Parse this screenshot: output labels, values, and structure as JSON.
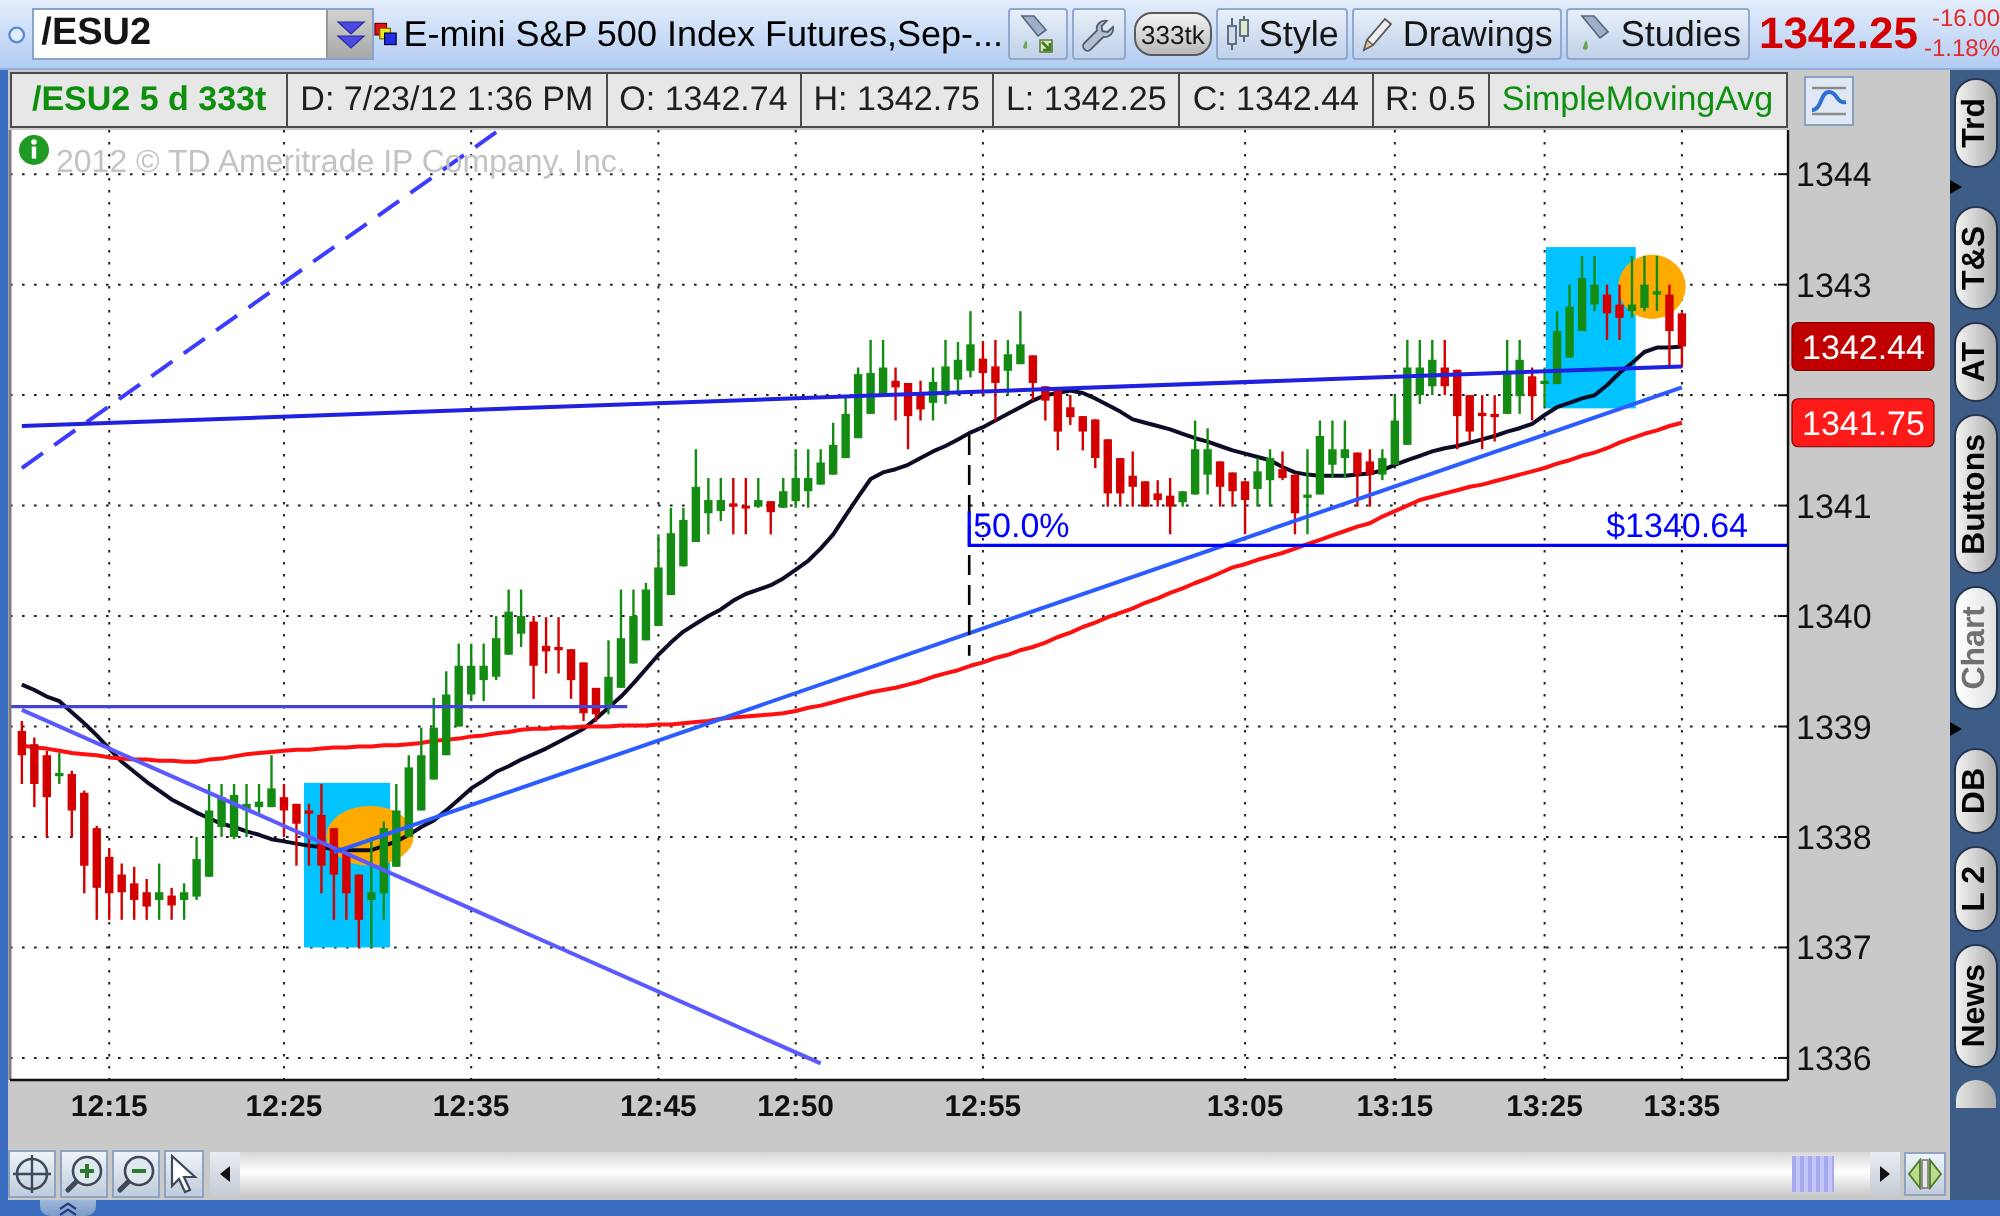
{
  "symbol_bar": {
    "symbol": "/ESU2",
    "description": "E-mini S&P 500 Index Futures,Sep-...",
    "buttons": [
      {
        "kind": "flask_arrow"
      },
      {
        "kind": "wrench"
      },
      {
        "kind": "pill",
        "label": "333tk"
      },
      {
        "kind": "candles",
        "label": "Style"
      },
      {
        "kind": "pencil",
        "label": "Drawings"
      },
      {
        "kind": "flask",
        "label": "Studies"
      }
    ],
    "last": "1342.25",
    "change": "-16.00",
    "change_percent": "-1.18%"
  },
  "info_bar": {
    "symbol": "/ESU2 5 d 333t",
    "fields": [
      "D: 7/23/12 1:36 PM",
      "O: 1342.74",
      "H: 1342.75",
      "L: 1342.25",
      "C: 1342.44",
      "R: 0.5"
    ],
    "study": "SimpleMovingAvg"
  },
  "chart": {
    "copyright": "2012 © TD Ameritrade IP Company, Inc.",
    "price_tags": [
      {
        "label": "1342.44",
        "color": "#c00000"
      },
      {
        "label": "1341.75",
        "color": "#ff1a1a"
      }
    ],
    "chart_data": [
      {
        "type": "candlestick",
        "categories": [
          null,
          null,
          null,
          null,
          null,
          null,
          null,
          "12:15",
          null,
          null,
          null,
          null,
          null,
          null,
          null,
          null,
          null,
          null,
          null,
          null,
          null,
          "12:25",
          null,
          null,
          null,
          null,
          null,
          null,
          null,
          null,
          null,
          null,
          null,
          null,
          null,
          null,
          "12:35",
          null,
          null,
          null,
          null,
          null,
          null,
          null,
          null,
          null,
          null,
          null,
          null,
          null,
          null,
          "12:45",
          null,
          null,
          null,
          null,
          null,
          null,
          null,
          null,
          null,
          null,
          "12:50",
          null,
          null,
          null,
          null,
          null,
          null,
          null,
          null,
          null,
          null,
          null,
          null,
          null,
          null,
          "12:55",
          null,
          null,
          null,
          null,
          null,
          null,
          null,
          null,
          null,
          null,
          null,
          null,
          null,
          null,
          null,
          null,
          null,
          null,
          null,
          null,
          "13:05",
          null,
          null,
          null,
          null,
          null,
          null,
          null,
          null,
          null,
          null,
          null,
          "13:15",
          null,
          null,
          null,
          null,
          null,
          null,
          null,
          null,
          null,
          null,
          null,
          "13:25",
          null,
          null,
          null,
          null,
          null,
          null,
          null,
          null,
          null,
          null,
          "13:35"
        ],
        "ohlc": [
          [
            1338.96,
            1339.05,
            1338.48,
            1338.74
          ],
          [
            1338.84,
            1338.9,
            1338.27,
            1338.48
          ],
          [
            1338.74,
            1338.78,
            1338.0,
            1338.36
          ],
          [
            1338.55,
            1338.76,
            1338.48,
            1338.58
          ],
          [
            1338.57,
            1338.6,
            1338.0,
            1338.24
          ],
          [
            1338.4,
            1338.42,
            1337.49,
            1337.74
          ],
          [
            1338.08,
            1338.1,
            1337.25,
            1337.54
          ],
          [
            1337.82,
            1337.9,
            1337.25,
            1337.49
          ],
          [
            1337.66,
            1337.76,
            1337.25,
            1337.5
          ],
          [
            1337.58,
            1337.73,
            1337.25,
            1337.43
          ],
          [
            1337.5,
            1337.62,
            1337.25,
            1337.37
          ],
          [
            1337.43,
            1337.76,
            1337.25,
            1337.5
          ],
          [
            1337.47,
            1337.54,
            1337.25,
            1337.38
          ],
          [
            1337.43,
            1337.58,
            1337.25,
            1337.5
          ],
          [
            1337.46,
            1338.0,
            1337.43,
            1337.8
          ],
          [
            1337.64,
            1338.48,
            1337.64,
            1338.24
          ],
          [
            1338.09,
            1338.48,
            1338.0,
            1338.36
          ],
          [
            1338.0,
            1338.48,
            1337.98,
            1338.38
          ],
          [
            1338.24,
            1338.48,
            1338.0,
            1338.3
          ],
          [
            1338.27,
            1338.48,
            1338.2,
            1338.32
          ],
          [
            1338.27,
            1338.74,
            1338.27,
            1338.44
          ],
          [
            1338.36,
            1338.48,
            1338.0,
            1338.24
          ],
          [
            1338.3,
            1338.3,
            1337.74,
            1338.12
          ],
          [
            1338.24,
            1338.3,
            1337.74,
            1338.21
          ],
          [
            1338.2,
            1338.48,
            1337.49,
            1337.74
          ],
          [
            1338.08,
            1338.08,
            1337.25,
            1337.66
          ],
          [
            1337.85,
            1337.91,
            1337.25,
            1337.49
          ],
          [
            1337.66,
            1337.66,
            1337.0,
            1337.25
          ],
          [
            1337.43,
            1338.0,
            1337.0,
            1337.5
          ],
          [
            1337.49,
            1338.14,
            1337.25,
            1338.08
          ],
          [
            1337.73,
            1338.48,
            1337.73,
            1338.24
          ],
          [
            1338.0,
            1338.74,
            1338.0,
            1338.63
          ],
          [
            1338.24,
            1338.99,
            1338.24,
            1338.74
          ],
          [
            1338.52,
            1339.26,
            1338.52,
            1338.99
          ],
          [
            1338.74,
            1339.5,
            1338.74,
            1339.29
          ],
          [
            1339.0,
            1339.75,
            1339.0,
            1339.55
          ],
          [
            1339.29,
            1339.75,
            1339.23,
            1339.55
          ],
          [
            1339.42,
            1339.75,
            1339.23,
            1339.55
          ],
          [
            1339.45,
            1340.0,
            1339.42,
            1339.8
          ],
          [
            1339.65,
            1340.24,
            1339.65,
            1340.04
          ],
          [
            1339.84,
            1340.24,
            1339.72,
            1340.0
          ],
          [
            1339.95,
            1340.0,
            1339.25,
            1339.55
          ],
          [
            1339.73,
            1339.99,
            1339.48,
            1339.68
          ],
          [
            1339.72,
            1339.99,
            1339.48,
            1339.69
          ],
          [
            1339.7,
            1339.7,
            1339.25,
            1339.42
          ],
          [
            1339.58,
            1339.58,
            1339.05,
            1339.12
          ],
          [
            1339.35,
            1339.35,
            1339.04,
            1339.11
          ],
          [
            1339.17,
            1339.78,
            1339.11,
            1339.45
          ],
          [
            1339.35,
            1340.24,
            1339.35,
            1339.8
          ],
          [
            1339.57,
            1340.24,
            1339.57,
            1340.0
          ],
          [
            1339.78,
            1340.3,
            1339.78,
            1340.24
          ],
          [
            1339.91,
            1340.74,
            1339.91,
            1340.44
          ],
          [
            1340.19,
            1340.98,
            1340.19,
            1340.75
          ],
          [
            1340.45,
            1340.98,
            1340.45,
            1340.87
          ],
          [
            1340.67,
            1341.51,
            1340.67,
            1341.17
          ],
          [
            1340.93,
            1341.25,
            1340.74,
            1341.05
          ],
          [
            1340.95,
            1341.25,
            1340.86,
            1341.05
          ],
          [
            1341.02,
            1341.25,
            1340.74,
            1340.99
          ],
          [
            1341.0,
            1341.25,
            1340.74,
            1340.98
          ],
          [
            1340.99,
            1341.25,
            1340.98,
            1341.05
          ],
          [
            1341.04,
            1341.04,
            1340.74,
            1340.94
          ],
          [
            1340.98,
            1341.25,
            1340.98,
            1341.13
          ],
          [
            1341.04,
            1341.51,
            1340.98,
            1341.25
          ],
          [
            1341.13,
            1341.51,
            1340.98,
            1341.25
          ],
          [
            1341.19,
            1341.51,
            1341.19,
            1341.39
          ],
          [
            1341.28,
            1341.75,
            1341.28,
            1341.55
          ],
          [
            1341.43,
            1342.0,
            1341.43,
            1341.83
          ],
          [
            1341.61,
            1342.25,
            1341.61,
            1342.19
          ],
          [
            1341.83,
            1342.5,
            1341.83,
            1342.2
          ],
          [
            1342.0,
            1342.5,
            1342.0,
            1342.25
          ],
          [
            1342.13,
            1342.25,
            1341.77,
            1342.07
          ],
          [
            1342.11,
            1342.11,
            1341.51,
            1341.81
          ],
          [
            1342.0,
            1342.13,
            1341.77,
            1341.87
          ],
          [
            1341.93,
            1342.25,
            1341.77,
            1342.12
          ],
          [
            1342.0,
            1342.5,
            1341.92,
            1342.26
          ],
          [
            1342.14,
            1342.48,
            1342.0,
            1342.32
          ],
          [
            1342.22,
            1342.76,
            1342.16,
            1342.46
          ],
          [
            1342.33,
            1342.49,
            1342.0,
            1342.2
          ],
          [
            1342.26,
            1342.5,
            1341.77,
            1342.11
          ],
          [
            1342.22,
            1342.5,
            1342.0,
            1342.37
          ],
          [
            1342.28,
            1342.76,
            1342.28,
            1342.46
          ],
          [
            1342.36,
            1342.36,
            1341.95,
            1342.11
          ],
          [
            1342.08,
            1342.08,
            1341.77,
            1341.95
          ],
          [
            1342.05,
            1342.05,
            1341.5,
            1341.67
          ],
          [
            1341.89,
            1342.0,
            1341.73,
            1341.8
          ],
          [
            1341.81,
            1341.81,
            1341.5,
            1341.67
          ],
          [
            1341.78,
            1341.78,
            1341.34,
            1341.43
          ],
          [
            1341.6,
            1341.6,
            1340.99,
            1341.11
          ],
          [
            1341.43,
            1341.43,
            1340.99,
            1341.11
          ],
          [
            1341.27,
            1341.49,
            1340.99,
            1341.17
          ],
          [
            1341.22,
            1341.22,
            1340.99,
            1340.99
          ],
          [
            1341.11,
            1341.23,
            1340.99,
            1341.05
          ],
          [
            1341.09,
            1341.25,
            1340.74,
            1340.99
          ],
          [
            1341.03,
            1341.13,
            1340.99,
            1341.13
          ],
          [
            1341.1,
            1341.77,
            1341.1,
            1341.51
          ],
          [
            1341.28,
            1341.7,
            1341.1,
            1341.51
          ],
          [
            1341.4,
            1341.4,
            1340.99,
            1341.17
          ],
          [
            1341.3,
            1341.3,
            1340.99,
            1341.13
          ],
          [
            1341.22,
            1341.22,
            1340.74,
            1341.05
          ],
          [
            1341.15,
            1341.43,
            1340.99,
            1341.31
          ],
          [
            1341.23,
            1341.51,
            1340.99,
            1341.43
          ],
          [
            1341.33,
            1341.49,
            1341.23,
            1341.25
          ],
          [
            1341.28,
            1341.28,
            1340.74,
            1340.93
          ],
          [
            1341.07,
            1341.51,
            1340.74,
            1341.1
          ],
          [
            1341.1,
            1341.77,
            1341.1,
            1341.63
          ],
          [
            1341.37,
            1341.77,
            1341.25,
            1341.51
          ],
          [
            1341.43,
            1341.77,
            1341.25,
            1341.51
          ],
          [
            1341.48,
            1341.48,
            1340.99,
            1341.28
          ],
          [
            1341.4,
            1341.51,
            1340.99,
            1341.28
          ],
          [
            1341.28,
            1341.51,
            1341.23,
            1341.43
          ],
          [
            1341.37,
            1342.0,
            1341.37,
            1341.77
          ],
          [
            1341.55,
            1342.5,
            1341.55,
            1342.25
          ],
          [
            1342.0,
            1342.5,
            1341.92,
            1342.25
          ],
          [
            1342.08,
            1342.5,
            1342.0,
            1342.32
          ],
          [
            1342.25,
            1342.5,
            1342.0,
            1342.08
          ],
          [
            1342.23,
            1342.23,
            1341.51,
            1341.81
          ],
          [
            1342.0,
            1342.0,
            1341.58,
            1341.67
          ],
          [
            1341.84,
            1342.0,
            1341.51,
            1341.81
          ],
          [
            1341.83,
            1342.0,
            1341.58,
            1341.8
          ],
          [
            1341.83,
            1342.5,
            1341.83,
            1342.22
          ],
          [
            1341.99,
            1342.5,
            1341.83,
            1342.32
          ],
          [
            1342.17,
            1342.25,
            1341.77,
            1341.99
          ],
          [
            1342.1,
            1342.25,
            1341.89,
            1342.13
          ],
          [
            1342.1,
            1342.76,
            1342.1,
            1342.58
          ],
          [
            1342.34,
            1343.0,
            1342.34,
            1342.8
          ],
          [
            1342.58,
            1343.26,
            1342.58,
            1343.06
          ],
          [
            1342.82,
            1343.26,
            1342.76,
            1343.0
          ],
          [
            1342.91,
            1343.0,
            1342.5,
            1342.74
          ],
          [
            1342.82,
            1343.0,
            1342.5,
            1342.7
          ],
          [
            1342.76,
            1343.26,
            1342.7,
            1342.82
          ],
          [
            1342.79,
            1343.26,
            1342.76,
            1343.0
          ],
          [
            1342.91,
            1343.26,
            1342.76,
            1342.94
          ],
          [
            1342.91,
            1343.0,
            1342.25,
            1342.58
          ],
          [
            1342.74,
            1342.75,
            1342.25,
            1342.44
          ]
        ],
        "series": [
          {
            "type": "line",
            "color": "#0c0c26",
            "values": [
              1339.38,
              1339.33,
              1339.27,
              1339.23,
              1339.13,
              1339.03,
              1338.92,
              1338.8,
              1338.68,
              1338.59,
              1338.5,
              1338.42,
              1338.34,
              1338.28,
              1338.22,
              1338.17,
              1338.12,
              1338.09,
              1338.05,
              1338.02,
              1337.98,
              1337.96,
              1337.94,
              1337.92,
              1337.91,
              1337.89,
              1337.88,
              1337.88,
              1337.88,
              1337.92,
              1337.96,
              1338.02,
              1338.09,
              1338.15,
              1338.24,
              1338.34,
              1338.44,
              1338.51,
              1338.59,
              1338.64,
              1338.7,
              1338.75,
              1338.8,
              1338.86,
              1338.92,
              1338.98,
              1339.07,
              1339.17,
              1339.27,
              1339.39,
              1339.52,
              1339.65,
              1339.76,
              1339.86,
              1339.93,
              1340.0,
              1340.06,
              1340.14,
              1340.2,
              1340.24,
              1340.28,
              1340.34,
              1340.42,
              1340.5,
              1340.61,
              1340.74,
              1340.91,
              1341.08,
              1341.24,
              1341.3,
              1341.33,
              1341.37,
              1341.43,
              1341.49,
              1341.54,
              1341.6,
              1341.66,
              1341.71,
              1341.77,
              1341.83,
              1341.89,
              1341.95,
              1342.0,
              1342.02,
              1342.04,
              1342.02,
              1341.97,
              1341.91,
              1341.85,
              1341.78,
              1341.75,
              1341.72,
              1341.69,
              1341.65,
              1341.61,
              1341.58,
              1341.54,
              1341.5,
              1341.47,
              1341.44,
              1341.41,
              1341.35,
              1341.3,
              1341.28,
              1341.27,
              1341.27,
              1341.27,
              1341.28,
              1341.29,
              1341.32,
              1341.37,
              1341.41,
              1341.45,
              1341.49,
              1341.52,
              1341.54,
              1341.57,
              1341.6,
              1341.63,
              1341.67,
              1341.7,
              1341.74,
              1341.82,
              1341.89,
              1341.93,
              1341.97,
              1342.0,
              1342.09,
              1342.2,
              1342.29,
              1342.39,
              1342.43,
              1342.43,
              1342.44
            ]
          },
          {
            "type": "line",
            "color": "#ff1010",
            "values": [
              1338.83,
              1338.81,
              1338.8,
              1338.78,
              1338.76,
              1338.75,
              1338.74,
              1338.72,
              1338.71,
              1338.7,
              1338.7,
              1338.69,
              1338.69,
              1338.68,
              1338.68,
              1338.7,
              1338.71,
              1338.73,
              1338.75,
              1338.76,
              1338.77,
              1338.78,
              1338.79,
              1338.79,
              1338.8,
              1338.81,
              1338.81,
              1338.82,
              1338.82,
              1338.83,
              1338.83,
              1338.84,
              1338.85,
              1338.87,
              1338.88,
              1338.89,
              1338.91,
              1338.92,
              1338.94,
              1338.95,
              1338.97,
              1338.98,
              1338.98,
              1338.99,
              1338.99,
              1339.0,
              1339.0,
              1339.0,
              1339.01,
              1339.01,
              1339.01,
              1339.02,
              1339.02,
              1339.03,
              1339.04,
              1339.05,
              1339.07,
              1339.08,
              1339.09,
              1339.1,
              1339.11,
              1339.12,
              1339.14,
              1339.17,
              1339.19,
              1339.22,
              1339.25,
              1339.28,
              1339.31,
              1339.33,
              1339.35,
              1339.38,
              1339.41,
              1339.45,
              1339.48,
              1339.51,
              1339.55,
              1339.58,
              1339.62,
              1339.65,
              1339.69,
              1339.72,
              1339.76,
              1339.81,
              1339.85,
              1339.9,
              1339.94,
              1339.99,
              1340.03,
              1340.07,
              1340.12,
              1340.16,
              1340.21,
              1340.25,
              1340.3,
              1340.34,
              1340.39,
              1340.44,
              1340.47,
              1340.51,
              1340.54,
              1340.57,
              1340.61,
              1340.65,
              1340.69,
              1340.73,
              1340.77,
              1340.81,
              1340.84,
              1340.9,
              1340.95,
              1341.0,
              1341.05,
              1341.08,
              1341.11,
              1341.14,
              1341.17,
              1341.19,
              1341.22,
              1341.25,
              1341.28,
              1341.31,
              1341.34,
              1341.38,
              1341.41,
              1341.45,
              1341.48,
              1341.52,
              1341.57,
              1341.61,
              1341.65,
              1341.68,
              1341.72,
              1341.75
            ]
          },
          {
            "type": "line",
            "color": "#3c3cff",
            "line_style": "dashed",
            "values": [
              1341.34,
              1341.42,
              1341.5,
              1341.58,
              1341.66,
              1341.74,
              1341.82,
              1341.9,
              1341.98,
              1342.06,
              1342.14,
              1342.22,
              1342.3,
              1342.38,
              1342.46,
              1342.54,
              1342.62,
              1342.7,
              1342.78,
              1342.86,
              1342.94,
              1343.02,
              1343.1,
              1343.18,
              1343.26,
              1343.34,
              1343.42,
              1343.5,
              1343.58,
              1343.66,
              1343.74,
              1343.82,
              1343.9,
              1343.98,
              1344.06,
              1344.14,
              1344.22,
              1344.3,
              1344.38,
              null,
              null,
              null,
              null,
              null,
              null,
              null,
              null,
              null,
              null,
              null,
              null,
              null,
              null,
              null,
              null,
              null,
              null,
              null,
              null,
              null,
              null,
              null,
              null,
              null,
              null,
              null,
              null,
              null,
              null,
              null,
              null,
              null,
              null,
              null,
              null,
              null,
              null,
              null,
              null,
              null,
              null,
              null,
              null,
              null,
              null,
              null,
              null,
              null,
              null,
              null,
              null,
              null,
              null,
              null,
              null,
              null,
              null,
              null,
              null,
              null,
              null,
              null,
              null,
              null,
              null,
              null,
              null,
              null,
              null,
              null,
              null,
              null,
              null,
              null,
              null,
              null,
              null,
              null,
              null,
              null,
              null,
              null,
              null,
              null,
              null,
              null,
              null,
              null,
              null,
              null,
              null,
              null,
              null,
              null
            ]
          },
          {
            "type": "line",
            "color": "#2020e0",
            "values": [
              1341.72,
              1341.73,
              1341.73,
              1341.74,
              1341.74,
              1341.74,
              1341.75,
              1341.75,
              1341.76,
              1341.76,
              1341.76,
              1341.77,
              1341.77,
              1341.78,
              1341.78,
              1341.78,
              1341.79,
              1341.79,
              1341.8,
              1341.8,
              1341.8,
              1341.81,
              1341.81,
              1341.82,
              1341.82,
              1341.82,
              1341.83,
              1341.83,
              1341.84,
              1341.84,
              1341.84,
              1341.85,
              1341.85,
              1341.86,
              1341.86,
              1341.86,
              1341.87,
              1341.87,
              1341.88,
              1341.88,
              1341.88,
              1341.89,
              1341.89,
              1341.9,
              1341.9,
              1341.9,
              1341.91,
              1341.91,
              1341.92,
              1341.92,
              1341.92,
              1341.93,
              1341.93,
              1341.94,
              1341.94,
              1341.94,
              1341.95,
              1341.95,
              1341.96,
              1341.96,
              1341.96,
              1341.97,
              1341.97,
              1341.98,
              1341.98,
              1341.98,
              1341.99,
              1341.99,
              1342.0,
              1342.0,
              1342.0,
              1342.01,
              1342.01,
              1342.02,
              1342.02,
              1342.02,
              1342.03,
              1342.03,
              1342.04,
              1342.04,
              1342.04,
              1342.05,
              1342.05,
              1342.06,
              1342.06,
              1342.06,
              1342.07,
              1342.07,
              1342.08,
              1342.08,
              1342.08,
              1342.09,
              1342.09,
              1342.1,
              1342.1,
              1342.1,
              1342.11,
              1342.11,
              1342.12,
              1342.12,
              1342.12,
              1342.13,
              1342.13,
              1342.14,
              1342.14,
              1342.14,
              1342.15,
              1342.15,
              1342.16,
              1342.16,
              1342.16,
              1342.17,
              1342.17,
              1342.18,
              1342.18,
              1342.18,
              1342.19,
              1342.19,
              1342.2,
              1342.2,
              1342.2,
              1342.21,
              1342.21,
              1342.22,
              1342.22,
              1342.22,
              1342.23,
              1342.23,
              1342.24,
              1342.24,
              1342.24,
              1342.25,
              1342.25,
              1342.26
            ]
          },
          {
            "type": "line",
            "color": "#5a5aff",
            "values": [
              1339.15,
              1339.1,
              1339.05,
              1339.0,
              1338.95,
              1338.9,
              1338.85,
              1338.8,
              1338.75,
              1338.7,
              1338.65,
              1338.6,
              1338.55,
              1338.5,
              1338.45,
              1338.4,
              1338.35,
              1338.3,
              1338.25,
              1338.2,
              1338.15,
              1338.1,
              1338.05,
              1338.0,
              1337.95,
              1337.9,
              1337.85,
              1337.8,
              1337.75,
              1337.7,
              1337.65,
              1337.6,
              1337.55,
              1337.5,
              1337.45,
              1337.4,
              1337.35,
              1337.3,
              1337.25,
              1337.2,
              1337.15,
              1337.1,
              1337.05,
              1337.0,
              1336.95,
              1336.9,
              1336.85,
              1336.8,
              1336.75,
              1336.7,
              1336.65,
              1336.6,
              1336.55,
              1336.5,
              1336.45,
              1336.4,
              1336.35,
              1336.3,
              1336.25,
              1336.2,
              1336.15,
              1336.1,
              1336.05,
              1336.0,
              1335.95,
              null,
              null,
              null,
              null,
              null,
              null,
              null,
              null,
              null,
              null,
              null,
              null,
              null,
              null,
              null,
              null,
              null,
              null,
              null,
              null,
              null,
              null,
              null,
              null,
              null,
              null,
              null,
              null,
              null,
              null,
              null,
              null,
              null,
              null,
              null,
              null,
              null,
              null,
              null,
              null,
              null,
              null,
              null,
              null,
              null,
              null,
              null,
              null,
              null,
              null,
              null,
              null,
              null,
              null,
              null,
              null,
              null,
              null,
              null,
              null,
              null,
              null,
              null,
              null,
              null,
              null,
              null,
              null,
              null
            ]
          },
          {
            "type": "line",
            "color": "#2a5cff",
            "values": [
              null,
              null,
              null,
              null,
              null,
              null,
              null,
              null,
              null,
              null,
              null,
              null,
              null,
              null,
              null,
              null,
              null,
              null,
              null,
              null,
              null,
              null,
              null,
              null,
              null,
              1337.86,
              1337.9,
              1337.94,
              1337.98,
              1338.02,
              1338.06,
              1338.09,
              1338.13,
              1338.17,
              1338.21,
              1338.25,
              1338.29,
              1338.33,
              1338.37,
              1338.41,
              1338.45,
              1338.48,
              1338.52,
              1338.56,
              1338.6,
              1338.64,
              1338.68,
              1338.72,
              1338.76,
              1338.8,
              1338.84,
              1338.87,
              1338.91,
              1338.95,
              1338.99,
              1339.03,
              1339.07,
              1339.11,
              1339.15,
              1339.19,
              1339.23,
              1339.26,
              1339.3,
              1339.34,
              1339.38,
              1339.42,
              1339.46,
              1339.5,
              1339.54,
              1339.58,
              1339.62,
              1339.65,
              1339.69,
              1339.73,
              1339.77,
              1339.81,
              1339.85,
              1339.89,
              1339.93,
              1339.97,
              1340.01,
              1340.04,
              1340.08,
              1340.12,
              1340.16,
              1340.2,
              1340.24,
              1340.28,
              1340.32,
              1340.36,
              1340.4,
              1340.43,
              1340.47,
              1340.51,
              1340.55,
              1340.59,
              1340.63,
              1340.67,
              1340.71,
              1340.75,
              1340.79,
              1340.82,
              1340.86,
              1340.9,
              1340.94,
              1340.98,
              1341.02,
              1341.06,
              1341.1,
              1341.14,
              1341.18,
              1341.21,
              1341.25,
              1341.29,
              1341.33,
              1341.37,
              1341.41,
              1341.45,
              1341.49,
              1341.53,
              1341.57,
              1341.6,
              1341.64,
              1341.68,
              1341.72,
              1341.76,
              1341.8,
              1341.84,
              1341.88,
              1341.92,
              1341.96,
              1341.99,
              1342.03,
              1342.07
            ]
          }
        ],
        "ylim": [
          1335.8,
          1344.4
        ],
        "yticks": [
          1336,
          1337,
          1338,
          1339,
          1340,
          1341,
          1343,
          1344
        ],
        "grid": true,
        "ref_lines": [
          {
            "axis": "y",
            "value": 1340.64,
            "label": "$1340.64",
            "color": "#0000ff"
          },
          {
            "axis": "y",
            "value": 1339.18,
            "color": "#4444dd"
          }
        ],
        "annotations": [
          "50.0%"
        ]
      }
    ]
  },
  "side_tabs": [
    {
      "kind": "tab",
      "label": "Trd",
      "selected": false
    },
    {
      "kind": "marker"
    },
    {
      "kind": "tab",
      "label": "T&S",
      "selected": false
    },
    {
      "kind": "tab",
      "label": "AT",
      "selected": false
    },
    {
      "kind": "tab",
      "label": "Buttons",
      "selected": false
    },
    {
      "kind": "tab",
      "label": "Chart",
      "selected": true
    },
    {
      "kind": "marker"
    },
    {
      "kind": "tab",
      "label": "DB",
      "selected": false
    },
    {
      "kind": "tab",
      "label": "L 2",
      "selected": false
    },
    {
      "kind": "tab",
      "label": "News",
      "selected": false
    },
    {
      "kind": "stub"
    }
  ]
}
